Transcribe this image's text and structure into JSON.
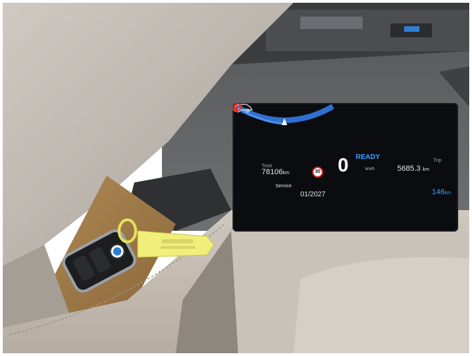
{
  "dashboard": {
    "total_label": "Total",
    "total_value": "78106",
    "total_unit": "km",
    "speed_value": "0",
    "speed_unit": "km/h",
    "status": "READY",
    "speed_limit": "30",
    "trip_label": "Trip",
    "trip_value": "5685.3",
    "trip_unit": "km",
    "service_label": "Service",
    "service_date": "01/2027",
    "range_value": "146",
    "range_unit": "km",
    "ready_color": "#3aa0ff",
    "warning_color": "#e0302a"
  },
  "key_tag": {
    "color": "#f2ee7a"
  },
  "icons": [
    "speed-limit-sign-icon",
    "car-service-icon",
    "parking-brake-warning-icon",
    "seatbelt-warning-icon",
    "bmw-logo-icon"
  ]
}
